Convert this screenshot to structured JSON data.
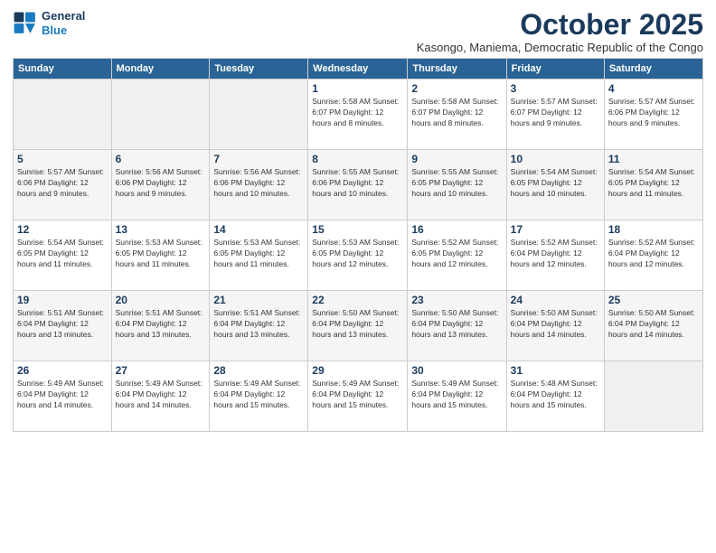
{
  "header": {
    "logo_line1": "General",
    "logo_line2": "Blue",
    "month": "October 2025",
    "location": "Kasongo, Maniema, Democratic Republic of the Congo"
  },
  "weekdays": [
    "Sunday",
    "Monday",
    "Tuesday",
    "Wednesday",
    "Thursday",
    "Friday",
    "Saturday"
  ],
  "weeks": [
    [
      {
        "day": "",
        "detail": ""
      },
      {
        "day": "",
        "detail": ""
      },
      {
        "day": "",
        "detail": ""
      },
      {
        "day": "1",
        "detail": "Sunrise: 5:58 AM\nSunset: 6:07 PM\nDaylight: 12 hours\nand 8 minutes."
      },
      {
        "day": "2",
        "detail": "Sunrise: 5:58 AM\nSunset: 6:07 PM\nDaylight: 12 hours\nand 8 minutes."
      },
      {
        "day": "3",
        "detail": "Sunrise: 5:57 AM\nSunset: 6:07 PM\nDaylight: 12 hours\nand 9 minutes."
      },
      {
        "day": "4",
        "detail": "Sunrise: 5:57 AM\nSunset: 6:06 PM\nDaylight: 12 hours\nand 9 minutes."
      }
    ],
    [
      {
        "day": "5",
        "detail": "Sunrise: 5:57 AM\nSunset: 6:06 PM\nDaylight: 12 hours\nand 9 minutes."
      },
      {
        "day": "6",
        "detail": "Sunrise: 5:56 AM\nSunset: 6:06 PM\nDaylight: 12 hours\nand 9 minutes."
      },
      {
        "day": "7",
        "detail": "Sunrise: 5:56 AM\nSunset: 6:06 PM\nDaylight: 12 hours\nand 10 minutes."
      },
      {
        "day": "8",
        "detail": "Sunrise: 5:55 AM\nSunset: 6:06 PM\nDaylight: 12 hours\nand 10 minutes."
      },
      {
        "day": "9",
        "detail": "Sunrise: 5:55 AM\nSunset: 6:05 PM\nDaylight: 12 hours\nand 10 minutes."
      },
      {
        "day": "10",
        "detail": "Sunrise: 5:54 AM\nSunset: 6:05 PM\nDaylight: 12 hours\nand 10 minutes."
      },
      {
        "day": "11",
        "detail": "Sunrise: 5:54 AM\nSunset: 6:05 PM\nDaylight: 12 hours\nand 11 minutes."
      }
    ],
    [
      {
        "day": "12",
        "detail": "Sunrise: 5:54 AM\nSunset: 6:05 PM\nDaylight: 12 hours\nand 11 minutes."
      },
      {
        "day": "13",
        "detail": "Sunrise: 5:53 AM\nSunset: 6:05 PM\nDaylight: 12 hours\nand 11 minutes."
      },
      {
        "day": "14",
        "detail": "Sunrise: 5:53 AM\nSunset: 6:05 PM\nDaylight: 12 hours\nand 11 minutes."
      },
      {
        "day": "15",
        "detail": "Sunrise: 5:53 AM\nSunset: 6:05 PM\nDaylight: 12 hours\nand 12 minutes."
      },
      {
        "day": "16",
        "detail": "Sunrise: 5:52 AM\nSunset: 6:05 PM\nDaylight: 12 hours\nand 12 minutes."
      },
      {
        "day": "17",
        "detail": "Sunrise: 5:52 AM\nSunset: 6:04 PM\nDaylight: 12 hours\nand 12 minutes."
      },
      {
        "day": "18",
        "detail": "Sunrise: 5:52 AM\nSunset: 6:04 PM\nDaylight: 12 hours\nand 12 minutes."
      }
    ],
    [
      {
        "day": "19",
        "detail": "Sunrise: 5:51 AM\nSunset: 6:04 PM\nDaylight: 12 hours\nand 13 minutes."
      },
      {
        "day": "20",
        "detail": "Sunrise: 5:51 AM\nSunset: 6:04 PM\nDaylight: 12 hours\nand 13 minutes."
      },
      {
        "day": "21",
        "detail": "Sunrise: 5:51 AM\nSunset: 6:04 PM\nDaylight: 12 hours\nand 13 minutes."
      },
      {
        "day": "22",
        "detail": "Sunrise: 5:50 AM\nSunset: 6:04 PM\nDaylight: 12 hours\nand 13 minutes."
      },
      {
        "day": "23",
        "detail": "Sunrise: 5:50 AM\nSunset: 6:04 PM\nDaylight: 12 hours\nand 13 minutes."
      },
      {
        "day": "24",
        "detail": "Sunrise: 5:50 AM\nSunset: 6:04 PM\nDaylight: 12 hours\nand 14 minutes."
      },
      {
        "day": "25",
        "detail": "Sunrise: 5:50 AM\nSunset: 6:04 PM\nDaylight: 12 hours\nand 14 minutes."
      }
    ],
    [
      {
        "day": "26",
        "detail": "Sunrise: 5:49 AM\nSunset: 6:04 PM\nDaylight: 12 hours\nand 14 minutes."
      },
      {
        "day": "27",
        "detail": "Sunrise: 5:49 AM\nSunset: 6:04 PM\nDaylight: 12 hours\nand 14 minutes."
      },
      {
        "day": "28",
        "detail": "Sunrise: 5:49 AM\nSunset: 6:04 PM\nDaylight: 12 hours\nand 15 minutes."
      },
      {
        "day": "29",
        "detail": "Sunrise: 5:49 AM\nSunset: 6:04 PM\nDaylight: 12 hours\nand 15 minutes."
      },
      {
        "day": "30",
        "detail": "Sunrise: 5:49 AM\nSunset: 6:04 PM\nDaylight: 12 hours\nand 15 minutes."
      },
      {
        "day": "31",
        "detail": "Sunrise: 5:48 AM\nSunset: 6:04 PM\nDaylight: 12 hours\nand 15 minutes."
      },
      {
        "day": "",
        "detail": ""
      }
    ]
  ]
}
